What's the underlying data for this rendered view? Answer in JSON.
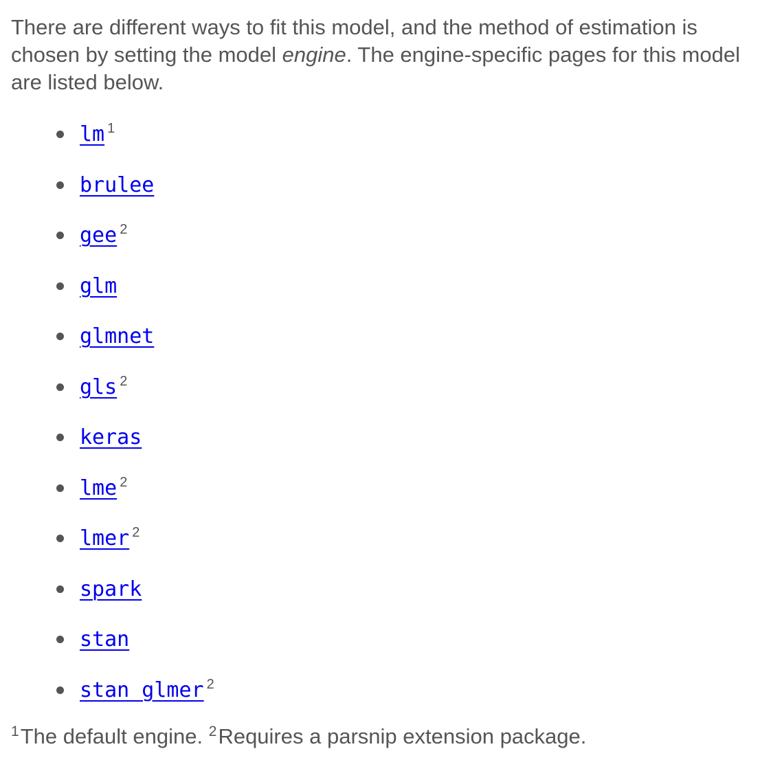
{
  "intro": {
    "part1": "There are different ways to fit this model, and the method of estimation is chosen by setting the model ",
    "emphasis": "engine",
    "part2": ". The engine-specific pages for this model are listed below."
  },
  "engines": [
    {
      "name": "lm",
      "mark": "1"
    },
    {
      "name": "brulee",
      "mark": ""
    },
    {
      "name": "gee",
      "mark": "2"
    },
    {
      "name": "glm",
      "mark": ""
    },
    {
      "name": "glmnet",
      "mark": ""
    },
    {
      "name": "gls",
      "mark": "2"
    },
    {
      "name": "keras",
      "mark": ""
    },
    {
      "name": "lme",
      "mark": "2"
    },
    {
      "name": "lmer",
      "mark": "2"
    },
    {
      "name": "spark",
      "mark": ""
    },
    {
      "name": "stan",
      "mark": ""
    },
    {
      "name": "stan_glmer",
      "mark": "2"
    }
  ],
  "footnotes": {
    "mark1": "1",
    "text1": "The default engine.",
    "mark2": "2",
    "text2": "Requires a parsnip extension package."
  },
  "colors": {
    "text": "#555555",
    "link": "#0000ee",
    "background": "#ffffff"
  }
}
